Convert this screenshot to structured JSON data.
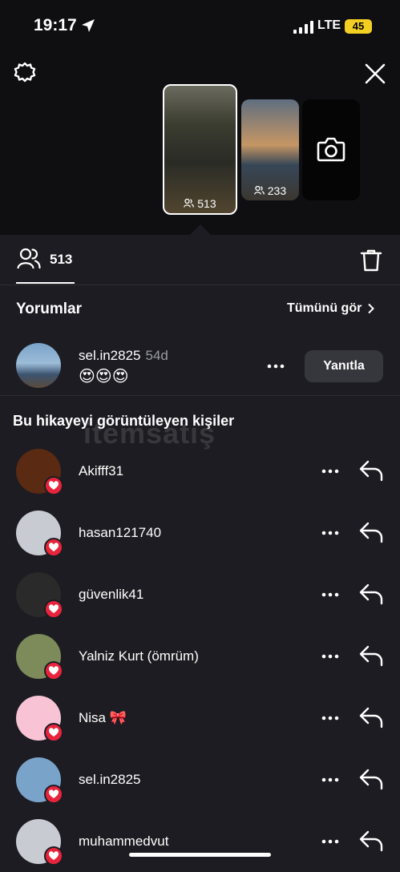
{
  "status_bar": {
    "time": "19:17",
    "network": "LTE",
    "battery": "45"
  },
  "stories": [
    {
      "views": "513",
      "selected": true
    },
    {
      "views": "233",
      "selected": false
    },
    {
      "type": "camera"
    }
  ],
  "tab": {
    "view_count": "513"
  },
  "comments": {
    "title": "Yorumlar",
    "see_all": "Tümünü gör",
    "item": {
      "username": "sel.in2825",
      "age": "54d",
      "text": "😍😍😍",
      "reply_label": "Yanıtla"
    }
  },
  "viewers": {
    "title": "Bu hikayeyi görüntüleyen kişiler",
    "watermark": "itemsatış",
    "items": [
      {
        "username": "Akifff31",
        "avatar_color": "#5a2a12"
      },
      {
        "username": "hasan121740",
        "avatar_color": "#c9cbd2"
      },
      {
        "username": "güvenlik41",
        "avatar_color": "#2a2a2a"
      },
      {
        "username": "Yalniz  Kurt (ömrüm)",
        "avatar_color": "#7d8a5a"
      },
      {
        "username": "Nisa 🎀",
        "avatar_color": "#f7c3d5"
      },
      {
        "username": "sel.in2825",
        "avatar_color": "#7aa3c9"
      },
      {
        "username": "muhammedvut",
        "avatar_color": "#c9cbd2"
      }
    ]
  },
  "colors": {
    "heart": "#e8243c",
    "battery": "#f3cf24",
    "background": "#1c1c22"
  }
}
